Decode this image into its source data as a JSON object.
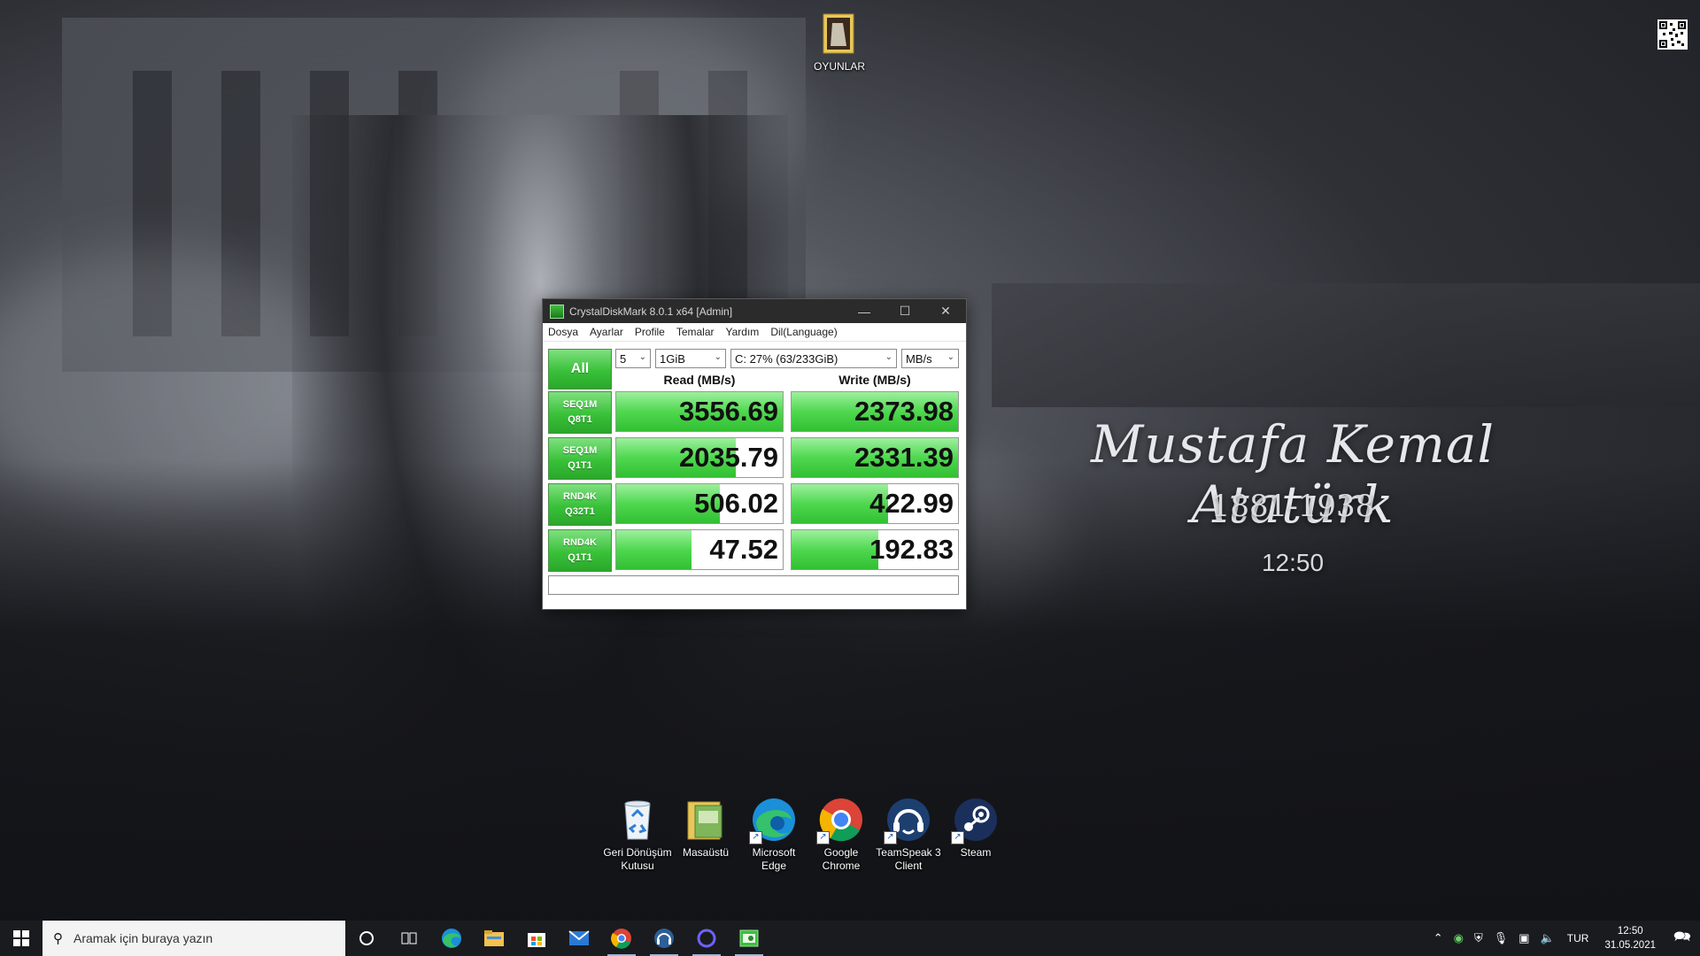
{
  "wallpaper": {
    "title": "Mustafa Kemal Atatürk",
    "years": "1881-1938",
    "clock": "12:50"
  },
  "desktop_icons": [
    {
      "name": "OYUNLAR",
      "icon": "folder-icon"
    },
    {
      "name": "Geri Dönüşüm Kutusu",
      "icon": "recycle-bin-icon"
    },
    {
      "name": "Masaüstü",
      "icon": "folder-icon"
    },
    {
      "name": "Microsoft Edge",
      "icon": "edge-icon"
    },
    {
      "name": "Google Chrome",
      "icon": "chrome-icon"
    },
    {
      "name": "TeamSpeak 3 Client",
      "icon": "teamspeak-icon"
    },
    {
      "name": "Steam",
      "icon": "steam-icon"
    }
  ],
  "cdm": {
    "title": "CrystalDiskMark 8.0.1 x64 [Admin]",
    "menu": [
      "Dosya",
      "Ayarlar",
      "Profile",
      "Temalar",
      "Yardım",
      "Dil(Language)"
    ],
    "all_label": "All",
    "count": "5",
    "size": "1GiB",
    "drive": "C: 27% (63/233GiB)",
    "unit": "MB/s",
    "read_header": "Read (MB/s)",
    "write_header": "Write (MB/s)",
    "rows": [
      {
        "line1": "SEQ1M",
        "line2": "Q8T1",
        "read": "3556.69",
        "write": "2373.98",
        "read_fill": 1.0,
        "write_fill": 1.0
      },
      {
        "line1": "SEQ1M",
        "line2": "Q1T1",
        "read": "2035.79",
        "write": "2331.39",
        "read_fill": 0.72,
        "write_fill": 1.0
      },
      {
        "line1": "RND4K",
        "line2": "Q32T1",
        "read": "506.02",
        "write": "422.99",
        "read_fill": 0.62,
        "write_fill": 0.58
      },
      {
        "line1": "RND4K",
        "line2": "Q1T1",
        "read": "47.52",
        "write": "192.83",
        "read_fill": 0.45,
        "write_fill": 0.52
      }
    ],
    "comment": ""
  },
  "taskbar": {
    "search_placeholder": "Aramak için buraya yazın",
    "pinned": [
      "edge-icon",
      "file-explorer-icon",
      "store-icon",
      "mail-icon",
      "chrome-icon",
      "teamspeak-icon",
      "cortana-app-icon",
      "crystaldiskmark-icon"
    ],
    "language": "TUR",
    "time": "12:50",
    "date": "31.05.2021"
  },
  "colors": {
    "accent_green": "#39c139",
    "titlebar": "#2b2b2b",
    "taskbar": "#1a1b1f"
  }
}
